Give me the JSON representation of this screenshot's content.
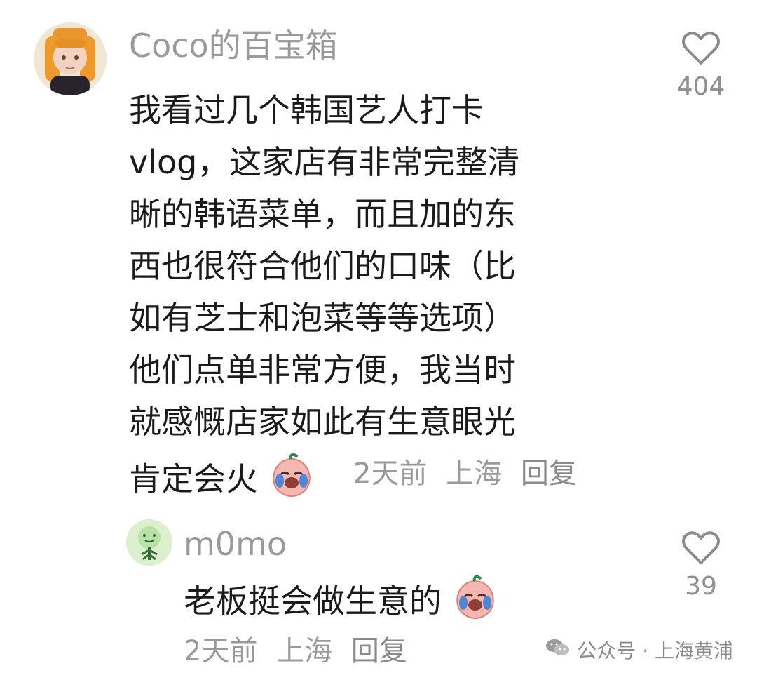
{
  "main_comment": {
    "username": "Coco的百宝箱",
    "text_lines": [
      "我看过几个韩国艺人打卡",
      "vlog，这家店有非常完整清",
      "晰的韩语菜单，而且加的东",
      "西也很符合他们的口味（比",
      "如有芝士和泡菜等等选项）",
      "他们点单非常方便，我当时",
      "就感慨店家如此有生意眼光",
      "肯定会火"
    ],
    "emoji": "laughing-crying-peach-emoji",
    "time": "2天前",
    "location": "上海",
    "reply_label": "回复",
    "like_count": "404"
  },
  "reply_comment": {
    "username": "m0mo",
    "text": "老板挺会做生意的",
    "emoji": "laughing-crying-peach-emoji",
    "time": "2天前",
    "location": "上海",
    "reply_label": "回复",
    "like_count": "39"
  },
  "watermark": {
    "text": "公众号 · 上海黄浦",
    "icon": "wechat-icon"
  },
  "colors": {
    "primary_text": "#1b1b1b",
    "secondary_text": "#9a9a9a",
    "background": "#ffffff"
  }
}
